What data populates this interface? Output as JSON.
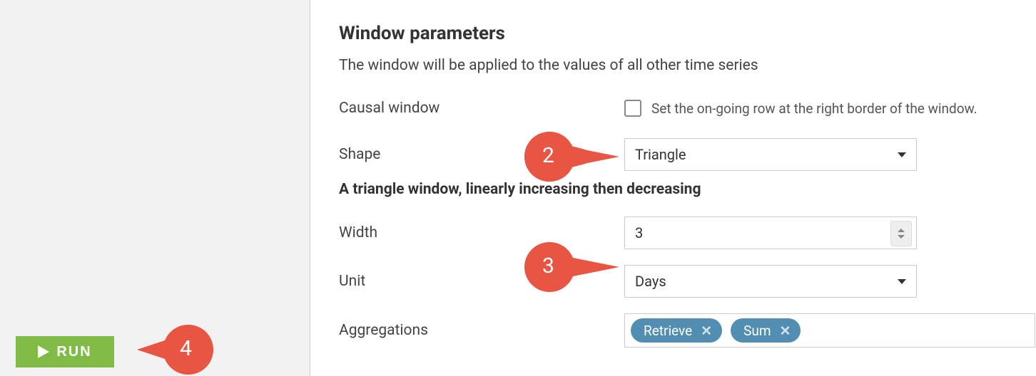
{
  "sidebar": {
    "run_label": "RUN"
  },
  "section": {
    "title": "Window parameters",
    "description": "The window will be applied to the values of all other time series",
    "shape_description": "A triangle window, linearly increasing then decreasing"
  },
  "fields": {
    "causal": {
      "label": "Causal window",
      "hint": "Set the on-going row at the right border of the window.",
      "checked": false
    },
    "shape": {
      "label": "Shape",
      "value": "Triangle"
    },
    "width": {
      "label": "Width",
      "value": "3"
    },
    "unit": {
      "label": "Unit",
      "value": "Days"
    },
    "aggregations": {
      "label": "Aggregations",
      "tags": [
        "Retrieve",
        "Sum"
      ]
    }
  },
  "markers": {
    "m2": "2",
    "m3": "3",
    "m4": "4"
  }
}
